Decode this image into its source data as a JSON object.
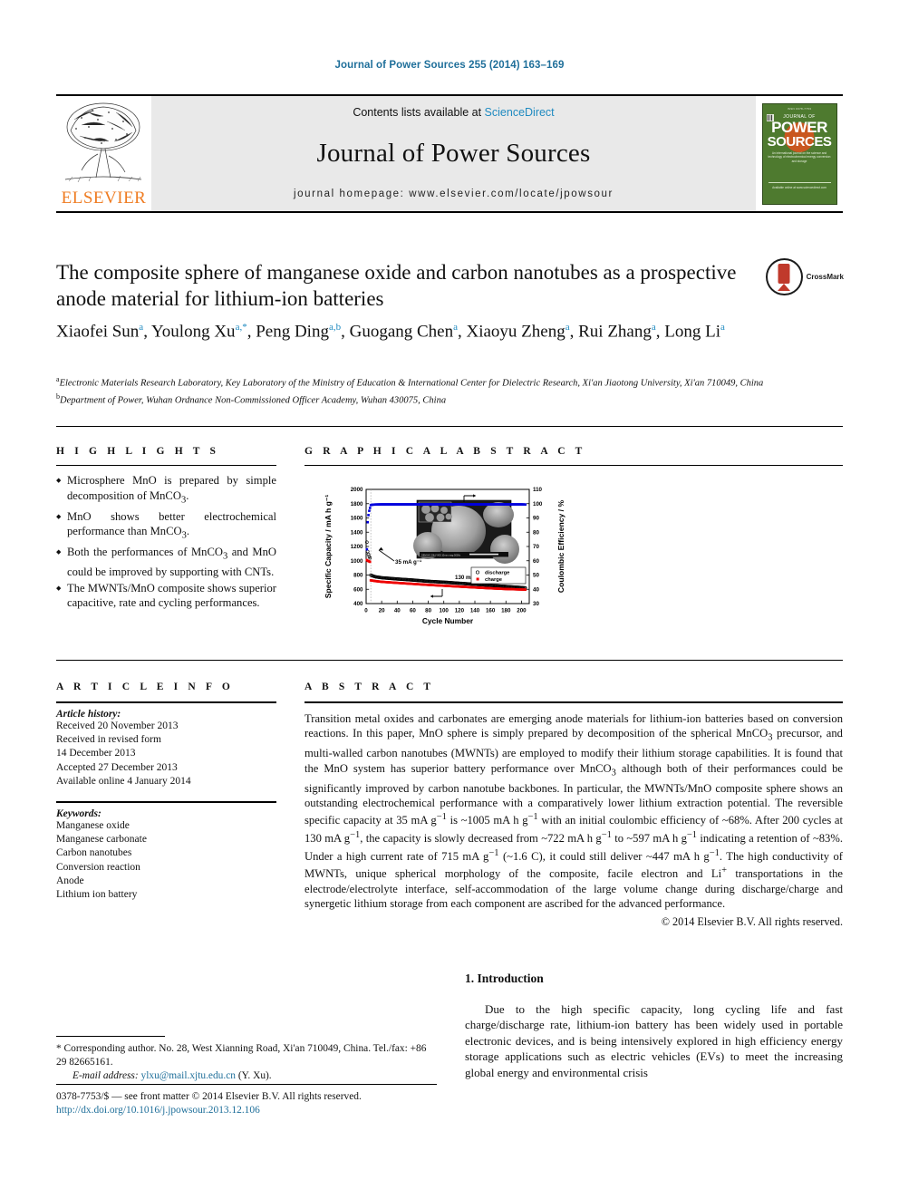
{
  "running_head": "Journal of Power Sources 255 (2014) 163–169",
  "header": {
    "publisher": "ELSEVIER",
    "contents_prefix": "Contents lists available at ",
    "contents_link": "ScienceDirect",
    "journal_name": "Journal of Power Sources",
    "homepage": "journal homepage: www.elsevier.com/locate/jpowsour",
    "cover": {
      "top_strip": "ISSN 0378-7753",
      "journal_of": "JOURNAL OF",
      "power": "POWER",
      "sources": "SOURCES",
      "description": "An international journal on the science and technology of electrochemical energy conversion and storage",
      "bottom": "Available online at www.sciencedirect.com"
    }
  },
  "article": {
    "title": "The composite sphere of manganese oxide and carbon nanotubes as a prospective anode material for lithium-ion batteries",
    "crossmark_label": "CrossMark",
    "authors": "Xiaofei Sun a, Youlong Xu a,*, Peng Ding a,b, Guogang Chen a, Xiaoyu Zheng a, Rui Zhang a, Long Li a",
    "author_list": [
      {
        "name": "Xiaofei Sun",
        "marks": "a"
      },
      {
        "name": "Youlong Xu",
        "marks": "a,*"
      },
      {
        "name": "Peng Ding",
        "marks": "a,b"
      },
      {
        "name": "Guogang Chen",
        "marks": "a"
      },
      {
        "name": "Xiaoyu Zheng",
        "marks": "a"
      },
      {
        "name": "Rui Zhang",
        "marks": "a"
      },
      {
        "name": "Long Li",
        "marks": "a"
      }
    ],
    "affiliations": [
      {
        "mark": "a",
        "text": "Electronic Materials Research Laboratory, Key Laboratory of the Ministry of Education & International Center for Dielectric Research, Xi'an Jiaotong University, Xi'an 710049, China"
      },
      {
        "mark": "b",
        "text": "Department of Power, Wuhan Ordnance Non-Commissioned Officer Academy, Wuhan 430075, China"
      }
    ]
  },
  "highlights": {
    "heading": "H I G H L I G H T S",
    "items": [
      "Microsphere MnO is prepared by simple decomposition of MnCO3.",
      "MnO shows better electrochemical performance than MnCO3.",
      "Both the performances of MnCO3 and MnO could be improved by supporting with CNTs.",
      "The MWNTs/MnO composite shows superior capacitive, rate and cycling performances."
    ]
  },
  "graphical_abstract": {
    "heading": "G R A P H I C A L   A B S T R A C T"
  },
  "chart_data": {
    "type": "scatter",
    "title": "",
    "xlabel": "Cycle Number",
    "ylabel": "Specific Capacity / mA h g⁻¹",
    "y2label": "Coulombic Efficiency / %",
    "xlim": [
      0,
      210
    ],
    "ylim": [
      400,
      2000
    ],
    "y2lim": [
      30,
      110
    ],
    "xticks": [
      0,
      20,
      40,
      60,
      80,
      100,
      120,
      140,
      160,
      180,
      200
    ],
    "yticks": [
      400,
      600,
      800,
      1000,
      1200,
      1400,
      1600,
      1800,
      2000
    ],
    "y2ticks": [
      30,
      40,
      50,
      60,
      70,
      80,
      90,
      100,
      110
    ],
    "grid": false,
    "legend_position": "center-right",
    "annotations": [
      "35 mA g⁻¹",
      "130 mA g⁻¹"
    ],
    "series": [
      {
        "name": "discharge",
        "marker": "open-circle",
        "color": "#000000",
        "axis": "left",
        "points": [
          [
            1,
            1260
          ],
          [
            2,
            1130
          ],
          [
            3,
            1090
          ],
          [
            4,
            1060
          ],
          [
            5,
            1040
          ],
          [
            6,
            800
          ],
          [
            8,
            790
          ],
          [
            12,
            775
          ],
          [
            20,
            762
          ],
          [
            40,
            745
          ],
          [
            60,
            730
          ],
          [
            80,
            712
          ],
          [
            100,
            700
          ],
          [
            120,
            685
          ],
          [
            140,
            670
          ],
          [
            160,
            655
          ],
          [
            180,
            640
          ],
          [
            200,
            625
          ],
          [
            205,
            620
          ]
        ]
      },
      {
        "name": "charge",
        "marker": "filled-square",
        "color": "#ee0000",
        "axis": "left",
        "points": [
          [
            1,
            1010
          ],
          [
            2,
            1000
          ],
          [
            3,
            995
          ],
          [
            4,
            990
          ],
          [
            5,
            985
          ],
          [
            6,
            725
          ],
          [
            8,
            722
          ],
          [
            12,
            715
          ],
          [
            20,
            705
          ],
          [
            40,
            690
          ],
          [
            60,
            676
          ],
          [
            80,
            662
          ],
          [
            100,
            650
          ],
          [
            120,
            638
          ],
          [
            140,
            626
          ],
          [
            160,
            614
          ],
          [
            180,
            604
          ],
          [
            200,
            597
          ],
          [
            205,
            595
          ]
        ]
      },
      {
        "name": "coulombic-efficiency",
        "marker": "filled-square",
        "color": "#0000dd",
        "axis": "right",
        "points": [
          [
            1,
            68
          ],
          [
            2,
            87
          ],
          [
            3,
            92
          ],
          [
            4,
            95
          ],
          [
            5,
            97
          ],
          [
            6,
            99
          ],
          [
            8,
            99.3
          ],
          [
            12,
            99.4
          ],
          [
            20,
            99.5
          ],
          [
            40,
            99.5
          ],
          [
            60,
            99.5
          ],
          [
            80,
            99.5
          ],
          [
            100,
            99.5
          ],
          [
            120,
            99.5
          ],
          [
            140,
            99.5
          ],
          [
            160,
            99.5
          ],
          [
            180,
            99.5
          ],
          [
            200,
            99.5
          ],
          [
            205,
            99.4
          ]
        ]
      }
    ],
    "legend": [
      {
        "label": "discharge",
        "marker": "open-circle",
        "color": "#000000"
      },
      {
        "label": "charge",
        "marker": "filled-square",
        "color": "#ee0000"
      }
    ]
  },
  "article_info": {
    "heading": "A R T I C L E   I N F O",
    "history_label": "Article history:",
    "history": [
      "Received 20 November 2013",
      "Received in revised form",
      "14 December 2013",
      "Accepted 27 December 2013",
      "Available online 4 January 2014"
    ],
    "keywords_label": "Keywords:",
    "keywords": [
      "Manganese oxide",
      "Manganese carbonate",
      "Carbon nanotubes",
      "Conversion reaction",
      "Anode",
      "Lithium ion battery"
    ]
  },
  "abstract": {
    "heading": "A B S T R A C T",
    "text": "Transition metal oxides and carbonates are emerging anode materials for lithium-ion batteries based on conversion reactions. In this paper, MnO sphere is simply prepared by decomposition of the spherical MnCO3 precursor, and multi-walled carbon nanotubes (MWNTs) are employed to modify their lithium storage capabilities. It is found that the MnO system has superior battery performance over MnCO3 although both of their performances could be significantly improved by carbon nanotube backbones. In particular, the MWNTs/MnO composite sphere shows an outstanding electrochemical performance with a comparatively lower lithium extraction potential. The reversible specific capacity at 35 mA g−1 is ~1005 mA h g−1 with an initial coulombic efficiency of ~68%. After 200 cycles at 130 mA g−1, the capacity is slowly decreased from ~722 mA h g−1 to ~597 mA h g−1 indicating a retention of ~83%. Under a high current rate of 715 mA g−1 (~1.6 C), it could still deliver ~447 mA h g−1. The high conductivity of MWNTs, unique spherical morphology of the composite, facile electron and Li+ transportations in the electrode/electrolyte interface, self-accommodation of the large volume change during discharge/charge and synergetic lithium storage from each component are ascribed for the advanced performance.",
    "copyright": "© 2014 Elsevier B.V. All rights reserved."
  },
  "introduction": {
    "number_and_title": "1. Introduction",
    "paragraph": "Due to the high specific capacity, long cycling life and fast charge/discharge rate, lithium-ion battery has been widely used in portable electronic devices, and is being intensively explored in high efficiency energy storage applications such as electric vehicles (EVs) to meet the increasing global energy and environmental crisis"
  },
  "footnotes": {
    "corresponding": "* Corresponding author. No. 28, West Xianning Road, Xi'an 710049, China. Tel./fax: +86 29 82665161.",
    "email_label": "E-mail address:",
    "email": "ylxu@mail.xjtu.edu.cn",
    "email_suffix": "(Y. Xu)."
  },
  "bottom": {
    "issn_line": "0378-7753/$ — see front matter © 2014 Elsevier B.V. All rights reserved.",
    "doi": "http://dx.doi.org/10.1016/j.jpowsour.2013.12.106"
  }
}
